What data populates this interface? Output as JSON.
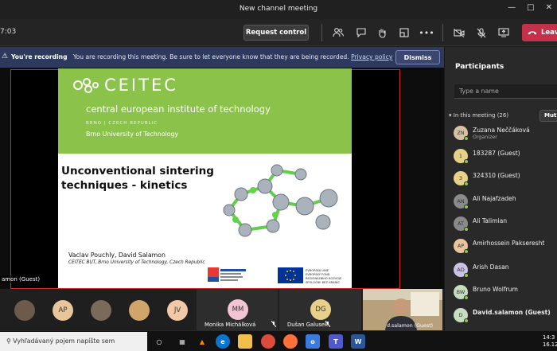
{
  "window": {
    "title": "New channel meeting"
  },
  "toolbar": {
    "timer": "7:03",
    "request_control_label": "Request control",
    "leave_label": "Leave"
  },
  "banner": {
    "heading": "You're recording",
    "message": "You are recording this meeting. Be sure to let everyone know that they are being recorded.",
    "link": "Privacy policy",
    "dismiss_label": "Dismiss"
  },
  "stage": {
    "presenter_tag": "amon (Guest)"
  },
  "slide": {
    "logo_text": "CEITEC",
    "institute": "central european institute of technology",
    "location": "BRNO | CZECH REPUBLIC",
    "university": "Brno University of Technology",
    "title_line1": "Unconventional sintering",
    "title_line2": "techniques - kinetics",
    "authors": "Vaclav Pouchly, David Salamon",
    "affiliation": "CEITEC BUT, Brno University of Technology, Czech Republic",
    "interreg_text": "INTERREG V-A",
    "eu_text_1": "EVROPSKÁ UNIE",
    "eu_text_2": "EVROPSKÝ FOND",
    "eu_text_3": "REGIONÁLNÍHO ROZVOJE",
    "eu_text_4": "SPOLOČNE BEZ HRANÍC"
  },
  "participants": {
    "title": "Participants",
    "search_placeholder": "Type a name",
    "section_label": "In this meeting (26)",
    "mute_label": "Mut",
    "list": [
      {
        "initials": "ZN",
        "name": "Zuzana Neččáková",
        "sub": "Organizer",
        "color": "#d7c2a4"
      },
      {
        "initials": "1",
        "name": "183287 (Guest)",
        "sub": "",
        "color": "#e6d08a"
      },
      {
        "initials": "3",
        "name": "324310 (Guest)",
        "sub": "",
        "color": "#e6d08a"
      },
      {
        "initials": "AN",
        "name": "Ali Najafzadeh",
        "sub": "",
        "color": "#8a8a8a"
      },
      {
        "initials": "AT",
        "name": "Ali Talimian",
        "sub": "",
        "color": "#8a8a8a"
      },
      {
        "initials": "AP",
        "name": "Amirhossein Pakseresht",
        "sub": "",
        "color": "#e8c59a"
      },
      {
        "initials": "AD",
        "name": "Arish Dasan",
        "sub": "",
        "color": "#c9c3e6"
      },
      {
        "initials": "BW",
        "name": "Bruno Wolfrum",
        "sub": "",
        "color": "#c8dcc0"
      },
      {
        "initials": "D",
        "name": "David.salamon (Guest)",
        "sub": "",
        "color": "#c8dcc0"
      }
    ]
  },
  "strip": {
    "avatars": [
      {
        "initials": "",
        "color": "#6d5a4a"
      },
      {
        "initials": "AP",
        "color": "#e8c59a"
      },
      {
        "initials": "",
        "color": "#7a6a5a"
      },
      {
        "initials": "",
        "color": "#d0a56a"
      },
      {
        "initials": "JV",
        "color": "#f2c9a8"
      }
    ],
    "tile1": {
      "initials": "MM",
      "name": "Monika Michálková",
      "color": "#f2c4d4"
    },
    "tile2": {
      "initials": "DG",
      "name": "Dušan Galusek",
      "color": "#e6d08a"
    },
    "video_name": "d.salamon (Guest)"
  },
  "taskbar": {
    "search_placeholder": "Vyhľadávaný pojem napíšte sem",
    "time": "14:3",
    "date": "16.12.2"
  }
}
